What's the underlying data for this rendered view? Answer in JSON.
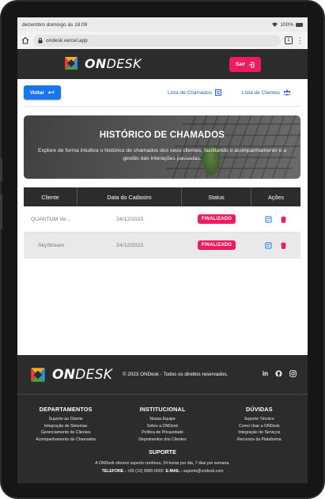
{
  "status_bar": {
    "time_text": "dezembro domingo às 18:09",
    "battery": "100%"
  },
  "browser": {
    "url": "ondesk.vercel.app",
    "tab_count": "1"
  },
  "header": {
    "logo_bold": "ON",
    "logo_rest": "DESK",
    "logout_label": "Sair"
  },
  "toolbar": {
    "back_label": "Voltar",
    "link_chamados": "Lista de Chamados",
    "link_clientes": "Lista de Clientes"
  },
  "hero": {
    "title": "HISTÓRICO DE CHAMADOS",
    "text": "Explore de forma intuitiva o histórico de chamados dos seus clientes, facilitando o acompanhamento e a gestão das interações passadas."
  },
  "table": {
    "columns": [
      "Cliente",
      "Data do Cadastro",
      "Status",
      "Ações"
    ],
    "rows": [
      {
        "client": "QUANTUM Ve...",
        "date": "24/12/2023",
        "status": "FINALIZADO"
      },
      {
        "client": "SkyStream",
        "date": "24/12/2023",
        "status": "FINALIZADO"
      }
    ]
  },
  "footer": {
    "copyright": "© 2023 ONDesk - Todos os direitos reservados.",
    "columns": [
      {
        "title": "DEPARTAMENTOS",
        "items": [
          "Suporte ao Cliente",
          "Integração de Sistemas",
          "Gerenciamento de Clientes",
          "Acompanhamento de Chamados"
        ]
      },
      {
        "title": "INSTITUCIONAL",
        "items": [
          "Nossa Equipe",
          "Sobre a ONDesk",
          "Política de Privacidade",
          "Depoimentos dos Clientes"
        ]
      },
      {
        "title": "DÚVIDAS",
        "items": [
          "Suporte Técnico",
          "Como Usar a ONDesk",
          "Integração de Serviços",
          "Recursos da Plataforma"
        ]
      }
    ],
    "support_title": "SUPORTE",
    "support_text": "A ONDesk oferece suporte contínuo, 24 horas por dia, 7 dias por semana.",
    "phone_label": "TELEFONE -",
    "phone": "+55 (12) 0000-0000",
    "email_label": "E-MAIL -",
    "email": "suporte@ondesk.com"
  },
  "colors": {
    "accent_pink": "#ee1b5e",
    "accent_blue": "#1a75e8",
    "dark": "#2c2c2c"
  },
  "icons": [
    "home-icon",
    "lock-icon",
    "logout-icon",
    "return-arrow-icon",
    "list-icon",
    "users-icon",
    "edit-icon",
    "trash-icon",
    "linkedin-icon",
    "github-icon",
    "instagram-icon"
  ]
}
